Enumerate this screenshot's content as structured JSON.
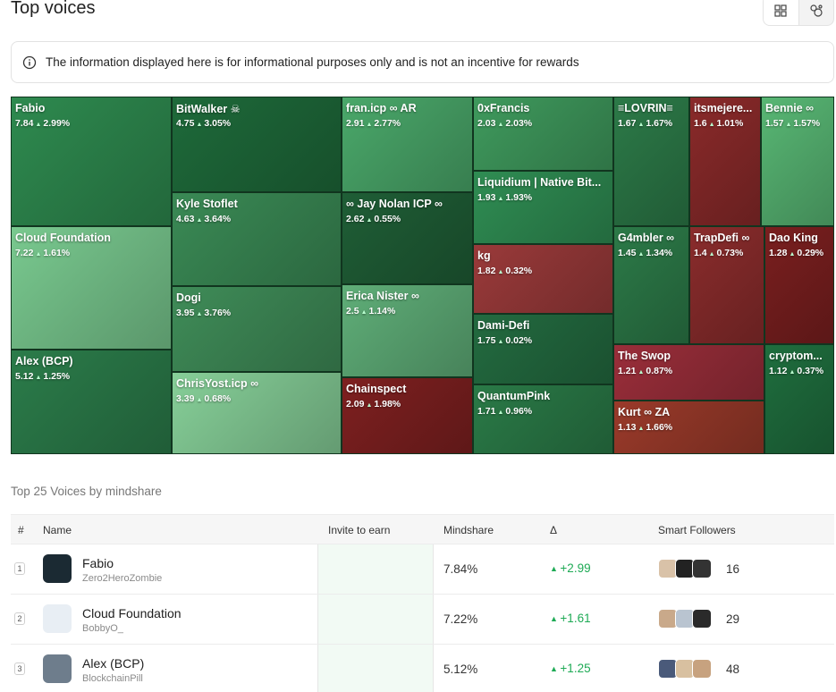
{
  "header": {
    "title": "Top voices"
  },
  "notice": {
    "text": "The information displayed here is for informational purposes only and is not an incentive for rewards"
  },
  "treemap": {
    "tiles": [
      {
        "name": "Fabio",
        "mindshare": "7.84",
        "change": "2.99%",
        "color": "#2e8a4f"
      },
      {
        "name": "BitWalker ☠",
        "mindshare": "4.75",
        "change": "3.05%",
        "color": "#1e6a3a"
      },
      {
        "name": "fran.icp ∞ AR",
        "mindshare": "2.91",
        "change": "2.77%",
        "color": "#4aa86a"
      },
      {
        "name": "0xFrancis",
        "mindshare": "2.03",
        "change": "2.03%",
        "color": "#3f9a5d"
      },
      {
        "name": "≡LOVRIN≡",
        "mindshare": "1.67",
        "change": "1.67%",
        "color": "#2c7a48"
      },
      {
        "name": "itsmejere...",
        "mindshare": "1.6",
        "change": "1.01%",
        "color": "#8a2a2a"
      },
      {
        "name": "Bennie ∞",
        "mindshare": "1.57",
        "change": "1.57%",
        "color": "#58b774"
      },
      {
        "name": "Kyle Stoflet",
        "mindshare": "4.63",
        "change": "3.64%",
        "color": "#3a8a55"
      },
      {
        "name": "∞ Jay Nolan ICP ∞",
        "mindshare": "2.62",
        "change": "0.55%",
        "color": "#1f5e36"
      },
      {
        "name": "Liquidium | Native Bit...",
        "mindshare": "1.93",
        "change": "1.93%",
        "color": "#2f8d53"
      },
      {
        "name": "Cloud Foundation",
        "mindshare": "7.22",
        "change": "1.61%",
        "color": "#79c98f"
      },
      {
        "name": "Dogi",
        "mindshare": "3.95",
        "change": "3.76%",
        "color": "#3f8c58"
      },
      {
        "name": "kg",
        "mindshare": "1.82",
        "change": "0.32%",
        "color": "#9a3a3a"
      },
      {
        "name": "G4mbler ∞",
        "mindshare": "1.45",
        "change": "1.34%",
        "color": "#2c7a48"
      },
      {
        "name": "TrapDefi ∞",
        "mindshare": "1.4",
        "change": "0.73%",
        "color": "#8a2c2c"
      },
      {
        "name": "Dao King",
        "mindshare": "1.28",
        "change": "0.29%",
        "color": "#7a1f1f"
      },
      {
        "name": "Erica Nister ∞",
        "mindshare": "2.5",
        "change": "1.14%",
        "color": "#5fae78"
      },
      {
        "name": "Dami-Defi",
        "mindshare": "1.75",
        "change": "0.02%",
        "color": "#236b40"
      },
      {
        "name": "Alex (BCP)",
        "mindshare": "5.12",
        "change": "1.25%",
        "color": "#2b7c4a"
      },
      {
        "name": "ChrisYost.icp ∞",
        "mindshare": "3.39",
        "change": "0.68%",
        "color": "#86cf98"
      },
      {
        "name": "Chainspect",
        "mindshare": "2.09",
        "change": "1.98%",
        "color": "#7e2020"
      },
      {
        "name": "QuantumPink",
        "mindshare": "1.71",
        "change": "0.96%",
        "color": "#2a7a47"
      },
      {
        "name": "The Swop",
        "mindshare": "1.21",
        "change": "0.87%",
        "color": "#9a2e3a"
      },
      {
        "name": "cryptom...",
        "mindshare": "1.12",
        "change": "0.37%",
        "color": "#1f6e3e"
      },
      {
        "name": "Kurt ∞ ZA",
        "mindshare": "1.13",
        "change": "1.66%",
        "color": "#9a3a2a"
      }
    ]
  },
  "table": {
    "title": "Top 25 Voices by mindshare",
    "headers": {
      "rank": "#",
      "name": "Name",
      "invite": "Invite to earn",
      "mindshare": "Mindshare",
      "delta": "Δ",
      "followers": "Smart Followers"
    },
    "rows": [
      {
        "rank": "1",
        "name": "Fabio",
        "handle": "Zero2HeroZombie",
        "mindshare": "7.84%",
        "delta": "+2.99",
        "followers": "16",
        "avatar_color": "#1b2a33"
      },
      {
        "rank": "2",
        "name": "Cloud Foundation",
        "handle": "BobbyO_",
        "mindshare": "7.22%",
        "delta": "+1.61",
        "followers": "29",
        "avatar_color": "#e8eef4"
      },
      {
        "rank": "3",
        "name": "Alex (BCP)",
        "handle": "BlockchainPill",
        "mindshare": "5.12%",
        "delta": "+1.25",
        "followers": "48",
        "avatar_color": "#6e7d8c"
      }
    ]
  },
  "colors": {
    "accent_green": "#1eaa55"
  }
}
